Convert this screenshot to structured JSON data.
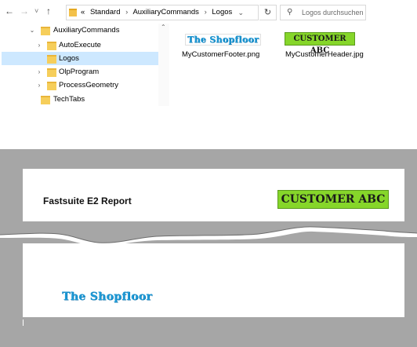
{
  "nav": {
    "back_icon": "←",
    "forward_icon": "→",
    "history_icon": "˅",
    "up_icon": "↑"
  },
  "address": {
    "overflow": "«",
    "crumbs": [
      "Standard",
      "AuxiliaryCommands",
      "Logos"
    ],
    "separator": "›",
    "dropdown_icon": "⌄",
    "refresh_icon": "↻"
  },
  "search": {
    "icon": "⚲",
    "placeholder": "Logos durchsuchen"
  },
  "tree": {
    "items": [
      {
        "label": "AuxiliaryCommands",
        "chevron": "⌄",
        "indent": 0,
        "selected": false
      },
      {
        "label": "AutoExecute",
        "chevron": "›",
        "indent": 1,
        "selected": false
      },
      {
        "label": "Logos",
        "chevron": "",
        "indent": 1,
        "selected": true
      },
      {
        "label": "OlpProgram",
        "chevron": "›",
        "indent": 1,
        "selected": false
      },
      {
        "label": "ProcessGeometry",
        "chevron": "›",
        "indent": 1,
        "selected": false
      },
      {
        "label": "TechTabs",
        "chevron": "",
        "indent": 0,
        "selected": false
      }
    ],
    "scroll_up": "⌃"
  },
  "files": [
    {
      "name": "MyCustomerFooter.png",
      "thumb_text": "The Shopfloor"
    },
    {
      "name": "MyCustomerHeader.jpg",
      "thumb_text": "CUSTOMER ABC"
    }
  ],
  "report": {
    "title": "Fastsuite E2 Report",
    "header_logo": "CUSTOMER ABC",
    "footer_logo": "The Shopfloor"
  },
  "colors": {
    "selection": "#cde8ff",
    "folder": "#f6ce5a",
    "logo_blue": "#1e9ad6",
    "logo_green": "#86d62a",
    "preview_bg": "#a6a6a6"
  }
}
